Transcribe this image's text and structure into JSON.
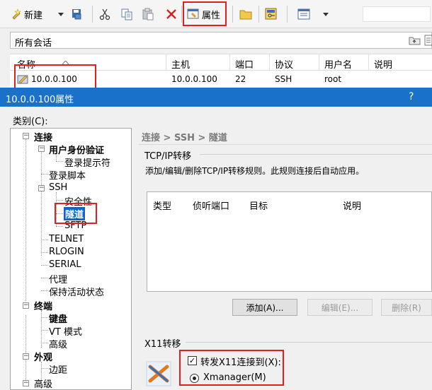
{
  "toolbar": {
    "new_label": "新建",
    "properties_label": "属性"
  },
  "session_bar": {
    "title": "所有会话"
  },
  "session_list": {
    "columns": [
      "名称",
      "主机",
      "端口",
      "协议",
      "用户名",
      "说明"
    ],
    "rows": [
      {
        "name": "10.0.0.100",
        "host": "10.0.0.100",
        "port": "22",
        "protocol": "SSH",
        "user": "root",
        "note": ""
      }
    ]
  },
  "dialog": {
    "title": "10.0.0.100属性",
    "help": "?"
  },
  "category": {
    "label": "类别(C):",
    "items": [
      "连接",
      "用户身份验证",
      "登录提示符",
      "登录脚本",
      "SSH",
      "安全性",
      "隧道",
      "SFTP",
      "TELNET",
      "RLOGIN",
      "SERIAL",
      "代理",
      "保持活动状态",
      "终端",
      "键盘",
      "VT 模式",
      "高级",
      "外观",
      "边距",
      "高级"
    ]
  },
  "breadcrumb": "连接 > SSH > 隧道",
  "tcpip": {
    "group_title": "TCP/IP转移",
    "description": "添加/编辑/删除TCP/IP转移规则。此规则连接后自动应用。",
    "columns": [
      "类型",
      "侦听端口",
      "目标",
      "说明"
    ],
    "add_label": "添加(A)...",
    "edit_label": "编辑(E)...",
    "delete_label": "删除(R)"
  },
  "x11": {
    "group_title": "X11转移",
    "forward_label": "转发X11连接到(X):",
    "forward_checked": true,
    "xmanager_label": "Xmanager(M)"
  },
  "colors": {
    "highlight_red": "#e02020",
    "dialog_title_blue": "#1971c9",
    "tree_selected": "#0a64d2"
  }
}
